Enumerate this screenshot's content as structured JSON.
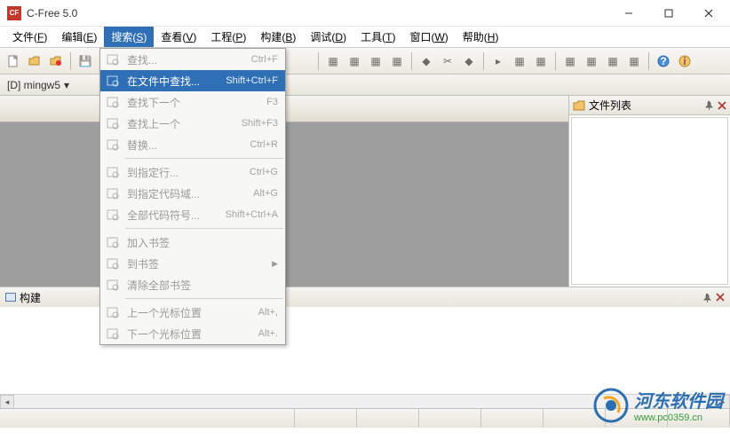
{
  "window": {
    "title": "C-Free 5.0"
  },
  "menubar": [
    {
      "label": "文件",
      "key": "F"
    },
    {
      "label": "编辑",
      "key": "E"
    },
    {
      "label": "搜索",
      "key": "S",
      "active": true
    },
    {
      "label": "查看",
      "key": "V"
    },
    {
      "label": "工程",
      "key": "P"
    },
    {
      "label": "构建",
      "key": "B"
    },
    {
      "label": "调试",
      "key": "D"
    },
    {
      "label": "工具",
      "key": "T"
    },
    {
      "label": "窗口",
      "key": "W"
    },
    {
      "label": "帮助",
      "key": "H"
    }
  ],
  "dropdown": [
    {
      "icon": "search",
      "label": "查找...",
      "shortcut": "Ctrl+F",
      "enabled": false
    },
    {
      "icon": "search-files",
      "label": "在文件中查找...",
      "shortcut": "Shift+Ctrl+F",
      "enabled": true,
      "hover": true
    },
    {
      "icon": "search-next",
      "label": "查找下一个",
      "shortcut": "F3",
      "enabled": false
    },
    {
      "icon": "search-prev",
      "label": "查找上一个",
      "shortcut": "Shift+F3",
      "enabled": false
    },
    {
      "icon": "replace",
      "label": "替换...",
      "shortcut": "Ctrl+R",
      "enabled": false
    },
    {
      "sep": true
    },
    {
      "icon": "goto-line",
      "label": "到指定行...",
      "shortcut": "Ctrl+G",
      "enabled": false
    },
    {
      "icon": "goto-block",
      "label": "到指定代码域...",
      "shortcut": "Alt+G",
      "enabled": false
    },
    {
      "icon": "symbols",
      "label": "全部代码符号...",
      "shortcut": "Shift+Ctrl+A",
      "enabled": false
    },
    {
      "sep": true
    },
    {
      "icon": "bookmark-add",
      "label": "加入书签",
      "shortcut": "",
      "enabled": false
    },
    {
      "icon": "bookmark-go",
      "label": "到书签",
      "shortcut": "",
      "enabled": false,
      "submenu": true
    },
    {
      "icon": "bookmark-clear",
      "label": "清除全部书签",
      "shortcut": "",
      "enabled": false
    },
    {
      "sep": true
    },
    {
      "icon": "cursor-prev",
      "label": "上一个光标位置",
      "shortcut": "Alt+,",
      "enabled": false
    },
    {
      "icon": "cursor-next",
      "label": "下一个光标位置",
      "shortcut": "Alt+.",
      "enabled": false
    }
  ],
  "secondbar": {
    "label": "[D] mingw5"
  },
  "right_panel": {
    "title": "文件列表"
  },
  "bottom_panel": {
    "title": "构建"
  },
  "watermark": {
    "cn": "河东软件园",
    "url": "www.pc0359.cn"
  }
}
